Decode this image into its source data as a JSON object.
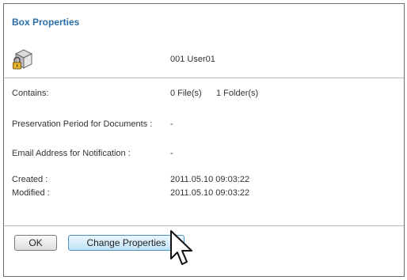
{
  "title": "Box Properties",
  "box": {
    "icon": "locked-box-icon",
    "name": "001 User01"
  },
  "fields": {
    "contains": {
      "label": "Contains:",
      "files": "0 File(s)",
      "folders": "1 Folder(s)"
    },
    "preservation": {
      "label": "Preservation Period for Documents :",
      "value": "-"
    },
    "email": {
      "label": "Email Address for Notification :",
      "value": "-"
    },
    "created": {
      "label": "Created :",
      "value": "2011.05.10 09:03:22"
    },
    "modified": {
      "label": "Modified :",
      "value": "2011.05.10 09:03:22"
    }
  },
  "buttons": {
    "ok": "OK",
    "change_properties": "Change Properties"
  },
  "cursor_icon": "mouse-pointer-icon",
  "colors": {
    "title": "#2a6fa8",
    "primary_button_top": "#eaf6fd",
    "primary_button_bottom": "#bfe3f7"
  }
}
